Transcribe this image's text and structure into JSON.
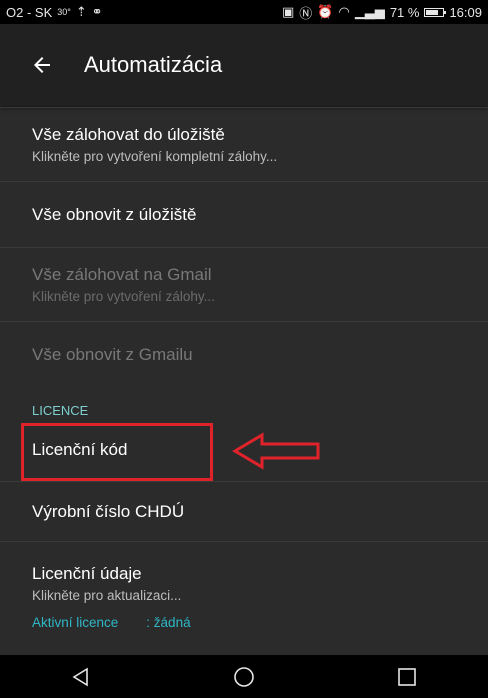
{
  "status_bar": {
    "carrier": "O2 - SK",
    "temperature": "30°",
    "battery_text": "71 %",
    "battery_level": 0.71,
    "time": "16:09"
  },
  "app_bar": {
    "title": "Automatizácia",
    "back_icon": "arrow-left-icon"
  },
  "items": [
    {
      "title": "Vše zálohovat do úložiště",
      "subtitle": "Klikněte pro vytvoření kompletní zálohy...",
      "enabled": true
    },
    {
      "title": "Vše obnovit z úložiště",
      "subtitle": "",
      "enabled": true
    },
    {
      "title": "Vše zálohovat na Gmail",
      "subtitle": "Klikněte pro vytvoření zálohy...",
      "enabled": false
    },
    {
      "title": "Vše obnovit z Gmailu",
      "subtitle": "",
      "enabled": false
    }
  ],
  "licence_section": {
    "header": "LICENCE",
    "license_code": "Licenční kód",
    "serial_number": "Výrobní číslo CHDÚ",
    "license_data_title": "Licenční údaje",
    "license_data_subtitle": "Klikněte pro aktualizaci...",
    "active_label": "Aktivní licence",
    "active_value": ": žádná"
  },
  "colors": {
    "accent": "#2fb7c6",
    "section_header": "#7ecfcf",
    "annotation": "#e0232b",
    "background": "#2b2b2b",
    "app_bar": "#212121"
  },
  "nav_bar": {
    "back": "triangle-back-icon",
    "home": "circle-home-icon",
    "recents": "square-recents-icon"
  }
}
